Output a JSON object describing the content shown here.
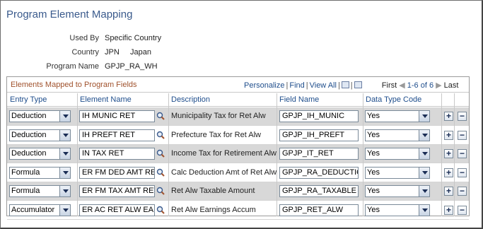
{
  "page": {
    "title": "Program Element Mapping"
  },
  "info": {
    "used_by_label": "Used By",
    "used_by_value": "Specific Country",
    "country_label": "Country",
    "country_code": "JPN",
    "country_name": "Japan",
    "program_label": "Program Name",
    "program_value": "GPJP_RA_WH"
  },
  "grid": {
    "title": "Elements Mapped to Program Fields",
    "personalize": "Personalize",
    "find": "Find",
    "view_all": "View All",
    "first": "First",
    "range": "1-6 of 6",
    "last": "Last",
    "columns": {
      "entry_type": "Entry Type",
      "element_name": "Element Name",
      "description": "Description",
      "field_name": "Field Name",
      "data_type_code": "Data Type Code"
    },
    "rows": [
      {
        "entry_type": "Deduction",
        "element_name": "IH MUNIC RET",
        "description": "Municipality Tax for Ret Alw",
        "field_name": "GPJP_IH_MUNIC",
        "data_type": "Yes"
      },
      {
        "entry_type": "Deduction",
        "element_name": "IH PREFT RET",
        "description": "Prefecture Tax for Ret Alw",
        "field_name": "GPJP_IH_PREFT",
        "data_type": "Yes"
      },
      {
        "entry_type": "Deduction",
        "element_name": "IN TAX RET",
        "description": "Income Tax for Retirement Alw",
        "field_name": "GPJP_IT_RET",
        "data_type": "Yes"
      },
      {
        "entry_type": "Formula",
        "element_name": "ER FM DED AMT RET",
        "description": "Calc Deduction Amt of Ret Alw",
        "field_name": "GPJP_RA_DEDUCTION",
        "data_type": "Yes"
      },
      {
        "entry_type": "Formula",
        "element_name": "ER FM TAX AMT RET",
        "description": "Ret Alw Taxable Amount",
        "field_name": "GPJP_RA_TAXABLE",
        "data_type": "Yes"
      },
      {
        "entry_type": "Accumulator",
        "element_name": "ER AC RET ALW EARN",
        "description": "Ret Alw Earnings Accum",
        "field_name": "GPJP_RET_ALW",
        "data_type": "Yes"
      }
    ]
  },
  "icons": {
    "lookup": "magnifier-icon",
    "add": "plus-icon",
    "delete": "minus-icon",
    "zoom": "zoom-grid-icon",
    "download": "download-icon"
  },
  "colors": {
    "title": "#3a5a8c",
    "link": "#1f4e8c",
    "grid_title": "#a0522d",
    "row_alt": "#d8d8d8"
  }
}
